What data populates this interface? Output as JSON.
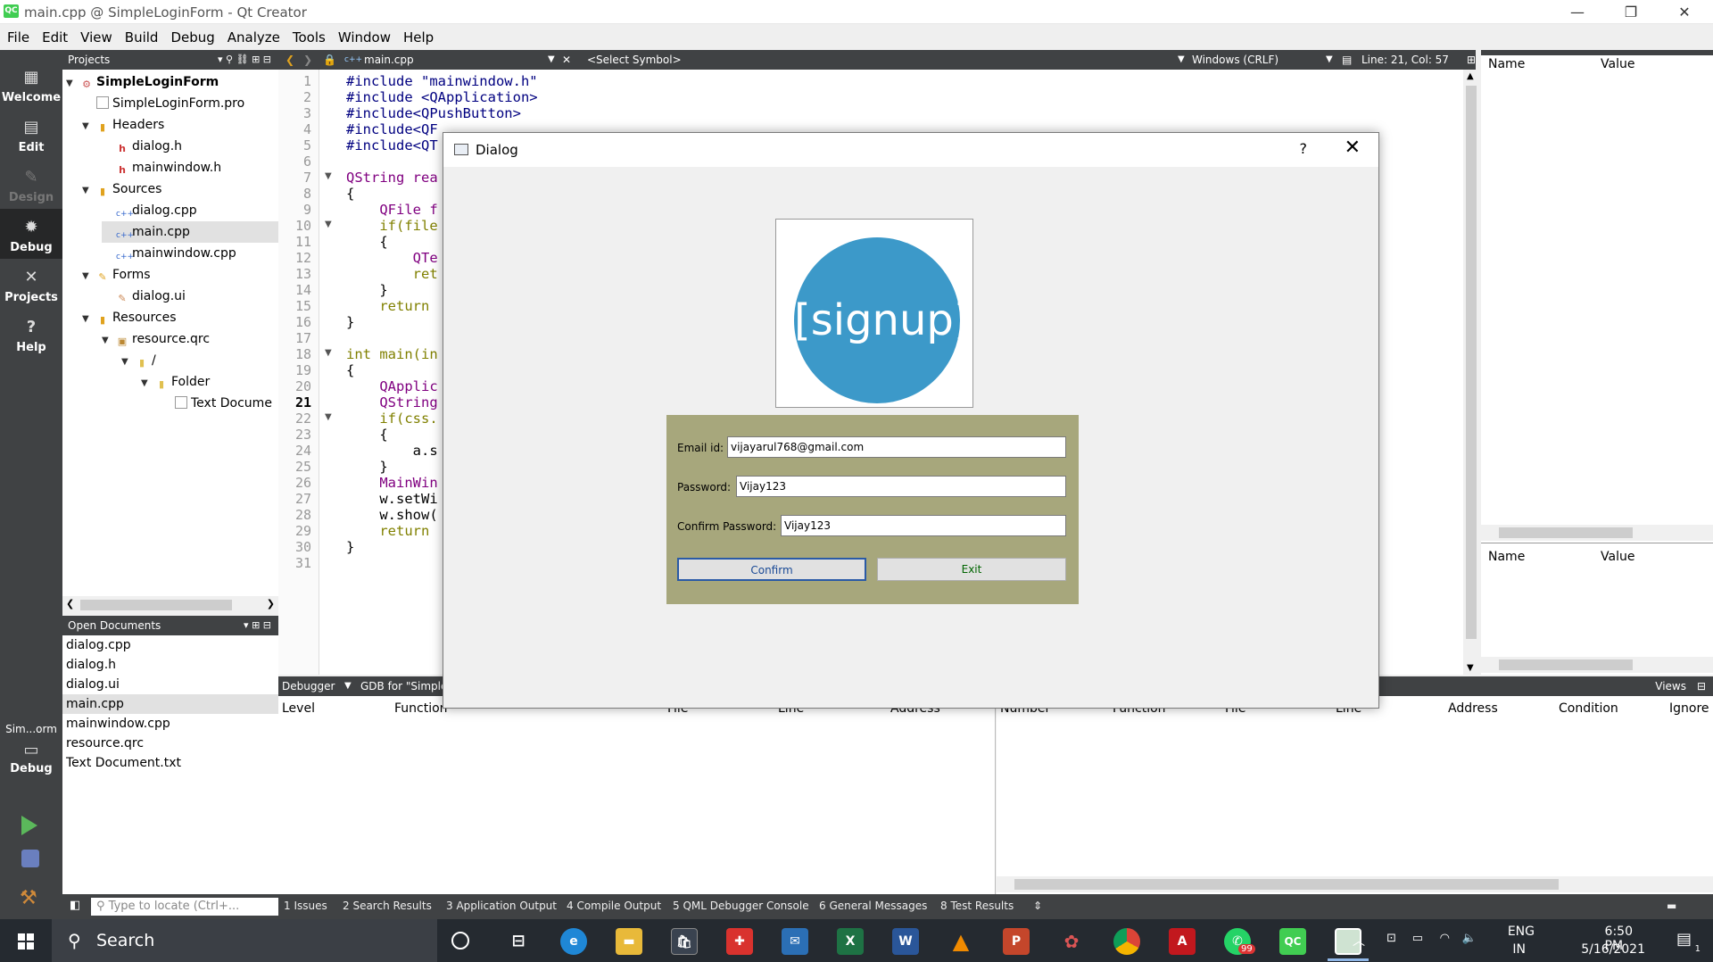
{
  "window": {
    "title": "main.cpp @ SimpleLoginForm - Qt Creator",
    "logo": "QC",
    "minimize": "—",
    "restore": "❐",
    "close": "✕"
  },
  "menu": [
    {
      "label": "File"
    },
    {
      "label": "Edit"
    },
    {
      "label": "View"
    },
    {
      "label": "Build"
    },
    {
      "label": "Debug"
    },
    {
      "label": "Analyze"
    },
    {
      "label": "Tools"
    },
    {
      "label": "Window"
    },
    {
      "label": "Help"
    }
  ],
  "modes": {
    "welcome": "Welcome",
    "edit": "Edit",
    "design": "Design",
    "debug": "Debug",
    "projects": "Projects",
    "help": "Help",
    "kit_name": "Sim...orm",
    "kit_mode": "Debug"
  },
  "projects_panel": {
    "title": "Projects",
    "tree": [
      {
        "label": "SimpleLoginForm",
        "bold": true
      },
      {
        "label": "SimpleLoginForm.pro"
      },
      {
        "label": "Headers"
      },
      {
        "label": "dialog.h"
      },
      {
        "label": "mainwindow.h"
      },
      {
        "label": "Sources"
      },
      {
        "label": "dialog.cpp"
      },
      {
        "label": "main.cpp"
      },
      {
        "label": "mainwindow.cpp"
      },
      {
        "label": "Forms"
      },
      {
        "label": "dialog.ui"
      },
      {
        "label": "Resources"
      },
      {
        "label": "resource.qrc"
      },
      {
        "label": "/"
      },
      {
        "label": "Folder"
      },
      {
        "label": "Text Docume"
      }
    ]
  },
  "open_documents": {
    "title": "Open Documents",
    "items": [
      "dialog.cpp",
      "dialog.h",
      "dialog.ui",
      "main.cpp",
      "mainwindow.cpp",
      "resource.qrc",
      "Text Document.txt"
    ]
  },
  "editor": {
    "file_tab": "main.cpp",
    "symbol": "<Select Symbol>",
    "line_ending": "Windows (CRLF)",
    "position": "Line: 21, Col: 57",
    "line_numbers": [
      "1",
      "2",
      "3",
      "4",
      "5",
      "6",
      "7",
      "8",
      "9",
      "10",
      "11",
      "12",
      "13",
      "14",
      "15",
      "16",
      "17",
      "18",
      "19",
      "20",
      "21",
      "22",
      "23",
      "24",
      "25",
      "26",
      "27",
      "28",
      "29",
      "30",
      "31"
    ],
    "current_line": "21",
    "code": [
      "#include \"mainwindow.h\"",
      "#include <QApplication>",
      "#include<QPushButton>",
      "#include<QF",
      "#include<QT",
      "",
      "QString rea",
      "{",
      "    QFile f",
      "    if(file",
      "    {",
      "        QTe",
      "        ret",
      "    }",
      "    return",
      "}",
      "",
      "int main(in",
      "{",
      "    QApplic",
      "    QString",
      "    if(css.",
      "    {",
      "        a.s",
      "    }",
      "    MainWin",
      "    w.setWi",
      "    w.show(",
      "    return",
      "}",
      ""
    ]
  },
  "right_pane": {
    "name_header": "Name",
    "value_header": "Value"
  },
  "debugger": {
    "label": "Debugger",
    "gdb": "GDB for \"Simple",
    "views": "Views",
    "stack_cols": [
      "Level",
      "Function",
      "File",
      "Line",
      "Address"
    ],
    "break_cols": [
      "Number",
      "Function",
      "File",
      "Line",
      "Address",
      "Condition",
      "Ignore"
    ]
  },
  "status": {
    "locator_placeholder": "Type to locate (Ctrl+...",
    "outputs": [
      "1  Issues",
      "2  Search Results",
      "3  Application Output",
      "4  Compile Output",
      "5  QML Debugger Console",
      "6  General Messages",
      "8  Test Results"
    ]
  },
  "dialog": {
    "title": "Dialog",
    "help": "?",
    "logo_text": "[signup]",
    "email_label": "Email id:",
    "email_value": "vijayarul768@gmail.com",
    "password_label": "Password:",
    "password_value": "Vijay123",
    "confirm_label": "Confirm Password:",
    "confirm_value": "Vijay123",
    "confirm_btn": "Confirm",
    "exit_btn": "Exit",
    "colors": {
      "form_bg": "#a7a77c",
      "logo_circle": "#3c99c9",
      "exit_text": "#006400"
    }
  },
  "taskbar": {
    "search": "Search",
    "lang": "ENG",
    "region": "IN",
    "time": "6:50 PM",
    "date": "5/16/2021",
    "whatsapp_badge": "99",
    "notif_badge": "1"
  }
}
